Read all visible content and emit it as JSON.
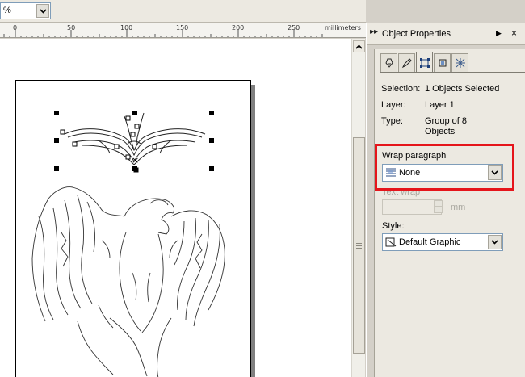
{
  "toolbar": {
    "zoom_value": "%"
  },
  "ruler": {
    "ticks": [
      "0",
      "50",
      "100",
      "150",
      "200",
      "250"
    ],
    "unit": "millimeters"
  },
  "docker": {
    "title": "Object Properties",
    "tabs": [
      "fill-tab",
      "outline-tab",
      "general-tab",
      "detail-tab",
      "internet-tab"
    ],
    "selection_label": "Selection:",
    "selection_value": "1 Objects Selected",
    "layer_label": "Layer:",
    "layer_value": "Layer 1",
    "type_label": "Type:",
    "type_value_line1": "Group of 8",
    "type_value_line2": "Objects",
    "wrap_label": "Wrap paragraph",
    "wrap_value": "None",
    "textwrap_label": "Text wrap",
    "textwrap_unit": "mm",
    "style_label": "Style:",
    "style_value": "Default Graphic"
  },
  "colors": {
    "highlight": "#e5151b",
    "panel": "#d4d0c8"
  }
}
